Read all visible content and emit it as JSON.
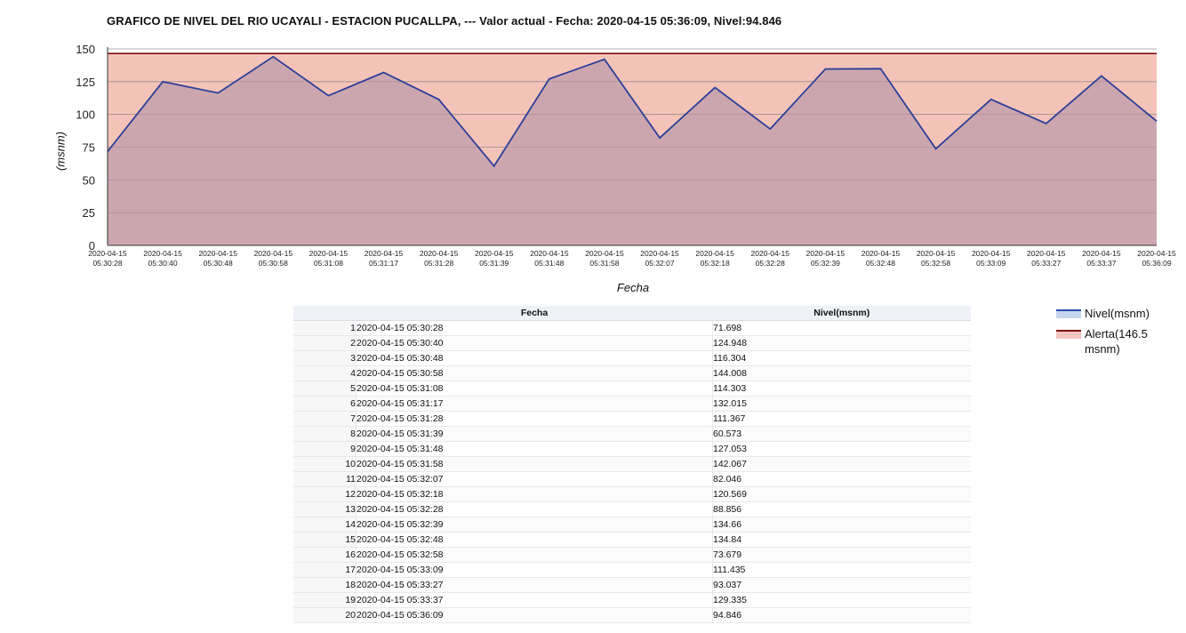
{
  "chart_data": {
    "type": "area",
    "title": "GRAFICO DE NIVEL DEL RIO UCAYALI - ESTACION PUCALLPA, --- Valor actual - Fecha: 2020-04-15 05:36:09, Nivel:94.846",
    "xlabel": "Fecha",
    "ylabel": "(msnm)",
    "ylim": [
      0,
      150
    ],
    "yticks": [
      "0",
      "25",
      "50",
      "75",
      "100",
      "125",
      "150"
    ],
    "x": [
      "2020-04-15 05:30:28",
      "2020-04-15 05:30:40",
      "2020-04-15 05:30:48",
      "2020-04-15 05:30:58",
      "2020-04-15 05:31:08",
      "2020-04-15 05:31:17",
      "2020-04-15 05:31:28",
      "2020-04-15 05:31:39",
      "2020-04-15 05:31:48",
      "2020-04-15 05:31:58",
      "2020-04-15 05:32:07",
      "2020-04-15 05:32:18",
      "2020-04-15 05:32:28",
      "2020-04-15 05:32:39",
      "2020-04-15 05:32:48",
      "2020-04-15 05:32:58",
      "2020-04-15 05:33:09",
      "2020-04-15 05:33:27",
      "2020-04-15 05:33:37",
      "2020-04-15 05:36:09"
    ],
    "series": [
      {
        "name": "Nivel(msnm)",
        "color": "#2b3f9a",
        "fill": "#c9a4ae",
        "values": [
          71.698,
          124.948,
          116.304,
          144.008,
          114.303,
          132.015,
          111.367,
          60.573,
          127.053,
          142.067,
          82.046,
          120.569,
          88.856,
          134.66,
          134.84,
          73.679,
          111.435,
          93.037,
          129.335,
          94.846
        ]
      },
      {
        "name": "Alerta(146.5 msnm)",
        "color": "#7a0e0e",
        "fill": "#f4c3b8",
        "value": 146.5
      }
    ],
    "grid": true,
    "legend": "right"
  },
  "table": {
    "headers": [
      "",
      "Fecha",
      "Nivel(msnm)"
    ],
    "rows": [
      [
        "1",
        "2020-04-15 05:30:28",
        "71.698"
      ],
      [
        "2",
        "2020-04-15 05:30:40",
        "124.948"
      ],
      [
        "3",
        "2020-04-15 05:30:48",
        "116.304"
      ],
      [
        "4",
        "2020-04-15 05:30:58",
        "144.008"
      ],
      [
        "5",
        "2020-04-15 05:31:08",
        "114.303"
      ],
      [
        "6",
        "2020-04-15 05:31:17",
        "132.015"
      ],
      [
        "7",
        "2020-04-15 05:31:28",
        "111.367"
      ],
      [
        "8",
        "2020-04-15 05:31:39",
        "60.573"
      ],
      [
        "9",
        "2020-04-15 05:31:48",
        "127.053"
      ],
      [
        "10",
        "2020-04-15 05:31:58",
        "142.067"
      ],
      [
        "11",
        "2020-04-15 05:32:07",
        "82.046"
      ],
      [
        "12",
        "2020-04-15 05:32:18",
        "120.569"
      ],
      [
        "13",
        "2020-04-15 05:32:28",
        "88.856"
      ],
      [
        "14",
        "2020-04-15 05:32:39",
        "134.66"
      ],
      [
        "15",
        "2020-04-15 05:32:48",
        "134.84"
      ],
      [
        "16",
        "2020-04-15 05:32:58",
        "73.679"
      ],
      [
        "17",
        "2020-04-15 05:33:09",
        "111.435"
      ],
      [
        "18",
        "2020-04-15 05:33:27",
        "93.037"
      ],
      [
        "19",
        "2020-04-15 05:33:37",
        "129.335"
      ],
      [
        "20",
        "2020-04-15 05:36:09",
        "94.846"
      ]
    ]
  }
}
